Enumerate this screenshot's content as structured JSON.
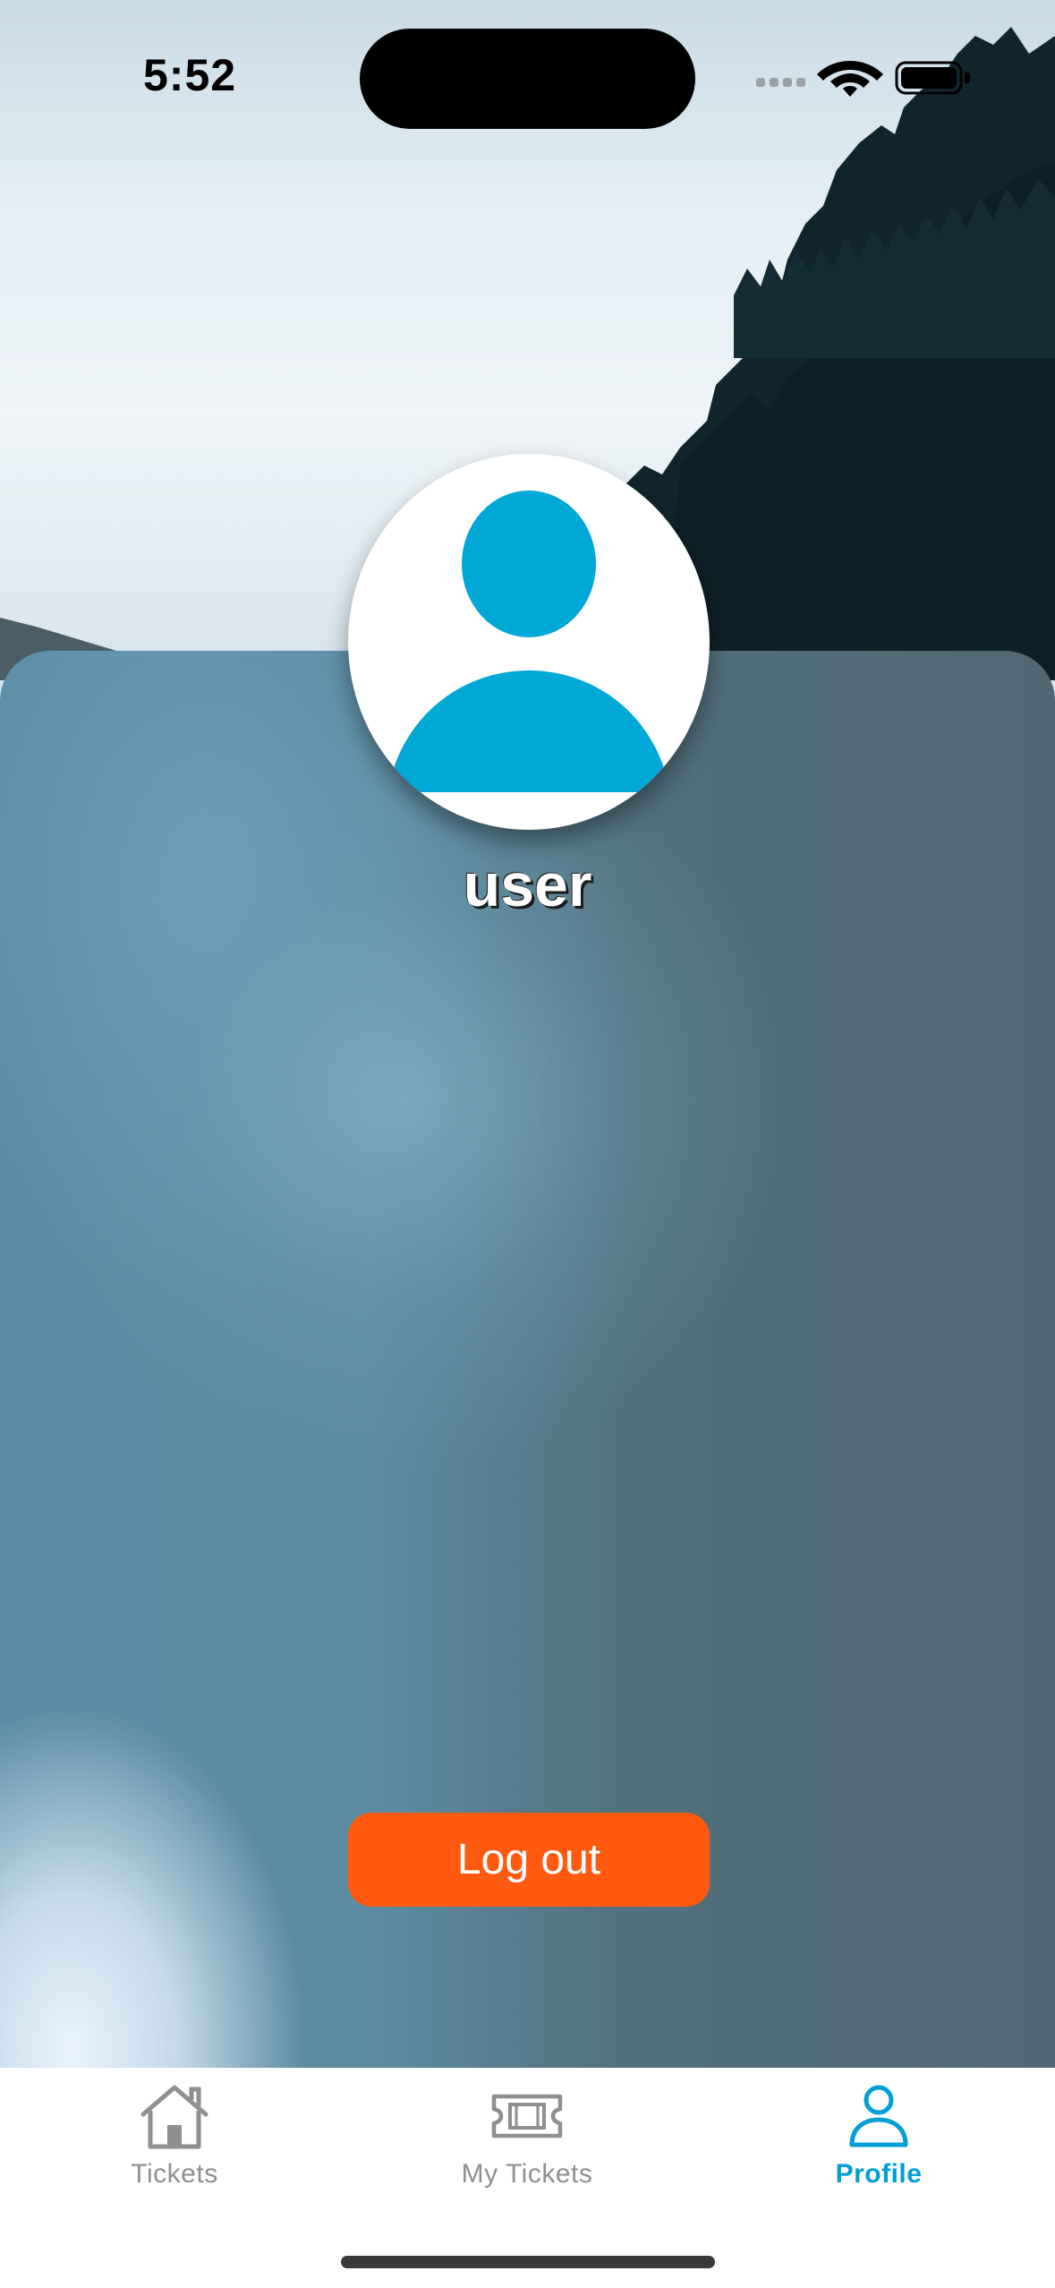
{
  "status_bar": {
    "time": "5:52",
    "icons": [
      "signal-icon",
      "wifi-icon",
      "battery-icon"
    ]
  },
  "profile": {
    "avatar_icon": "user-avatar-icon",
    "username": "user"
  },
  "actions": {
    "logout_label": "Log out"
  },
  "tab_bar": {
    "tabs": [
      {
        "label": "Tickets",
        "icon": "home-icon",
        "active": false
      },
      {
        "label": "My Tickets",
        "icon": "ticket-icon",
        "active": false
      },
      {
        "label": "Profile",
        "icon": "person-icon",
        "active": true
      }
    ]
  },
  "colors": {
    "accent": "#009fd4",
    "logout_button": "#ff5a0f",
    "avatar_fill": "#00a8d6",
    "inactive_tab": "#8e8e93"
  }
}
